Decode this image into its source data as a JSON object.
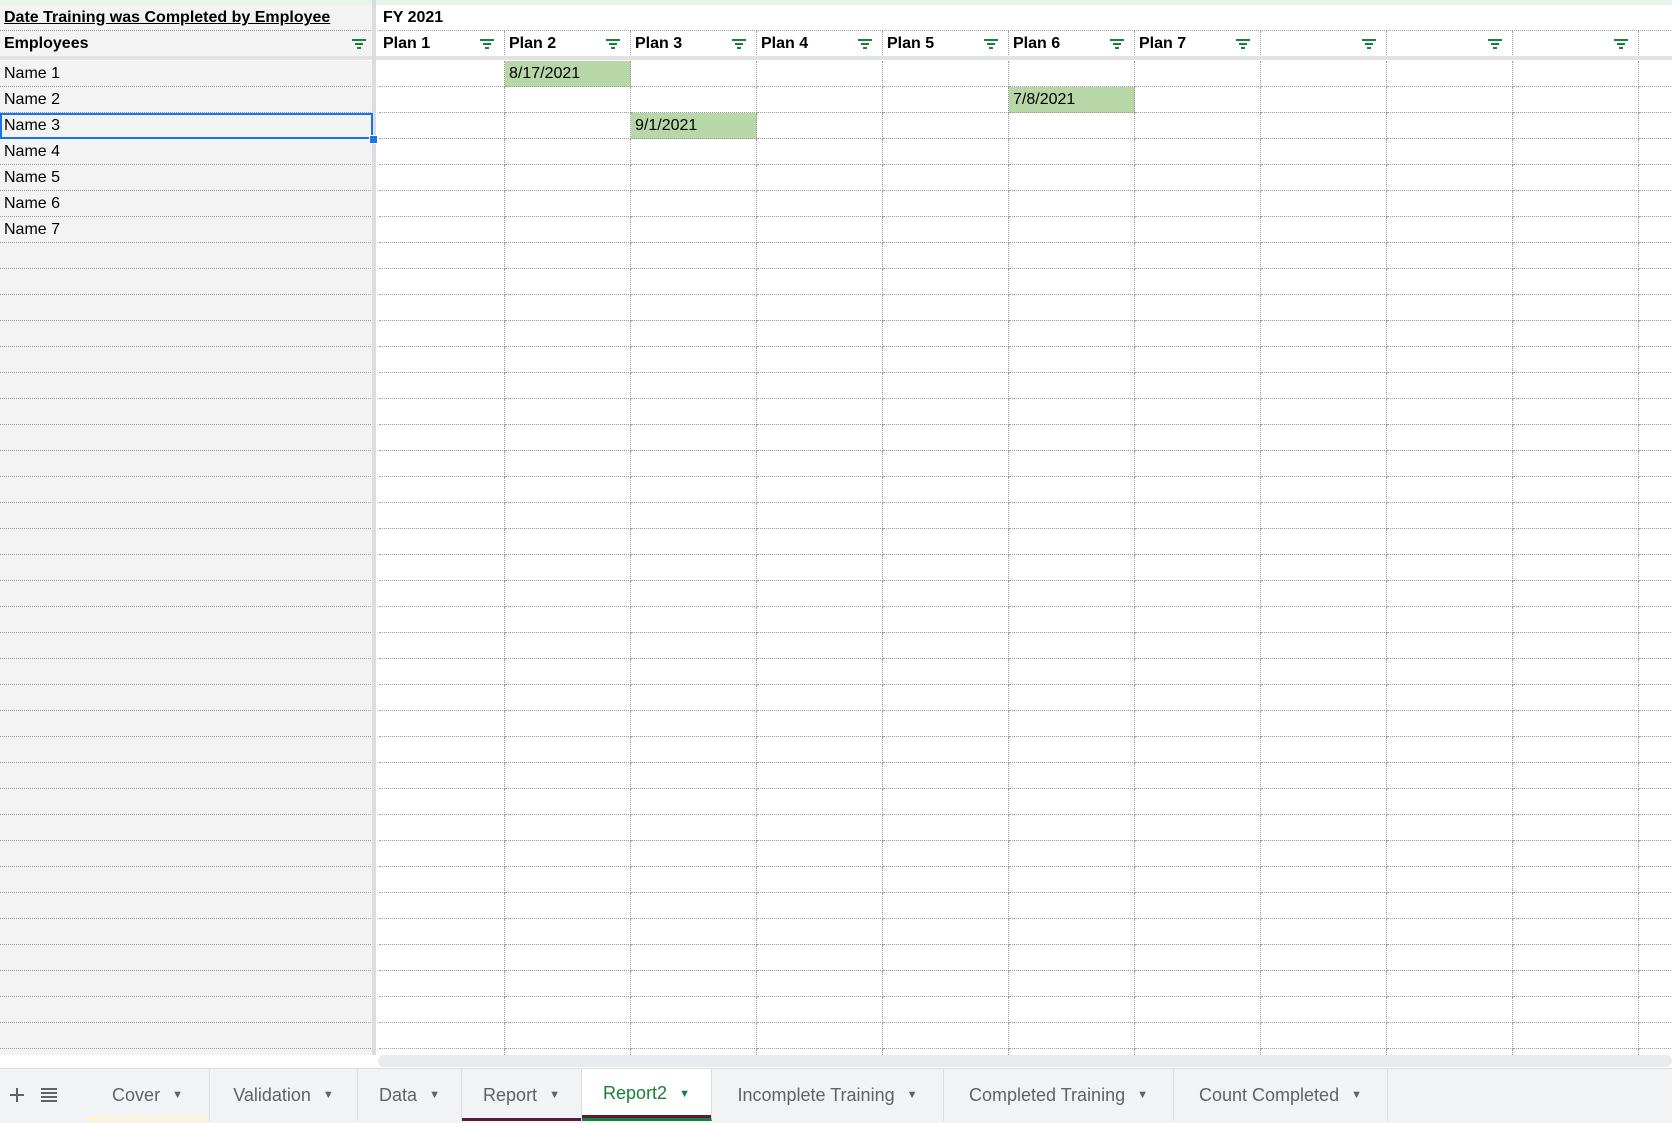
{
  "sheet": {
    "title": "Date Training was Completed by Employee",
    "fiscal_year": "FY 2021",
    "employees_header": "Employees",
    "plans": [
      "Plan 1",
      "Plan 2",
      "Plan 3",
      "Plan 4",
      "Plan 5",
      "Plan 6",
      "Plan 7",
      "",
      "",
      "",
      ""
    ],
    "employees": [
      "Name 1",
      "Name 2",
      "Name 3",
      "Name 4",
      "Name 5",
      "Name 6",
      "Name 7"
    ],
    "completions": [
      {
        "employee": "Name 1",
        "plan": "Plan 2",
        "date": "8/17/2021"
      },
      {
        "employee": "Name 2",
        "plan": "Plan 6",
        "date": "7/8/2021"
      },
      {
        "employee": "Name 3",
        "plan": "Plan 3",
        "date": "9/1/2021"
      }
    ],
    "selected_cell": "Name 3",
    "completed_fill_color": "#b7d7a8",
    "selection_color": "#1a73e8"
  },
  "tabbar": {
    "add_icon": "plus-icon",
    "list_icon": "all-sheets-icon",
    "active_tab": "Report2",
    "tabs": [
      {
        "label": "Cover",
        "color": "#fff4c4"
      },
      {
        "label": "Validation",
        "color": ""
      },
      {
        "label": "Data",
        "color": ""
      },
      {
        "label": "Report",
        "color": "#5b1a3a"
      },
      {
        "label": "Report2",
        "color": "#5b1a3a"
      },
      {
        "label": "Incomplete Training",
        "color": ""
      },
      {
        "label": "Completed Training",
        "color": ""
      },
      {
        "label": "Count Completed",
        "color": ""
      }
    ]
  }
}
